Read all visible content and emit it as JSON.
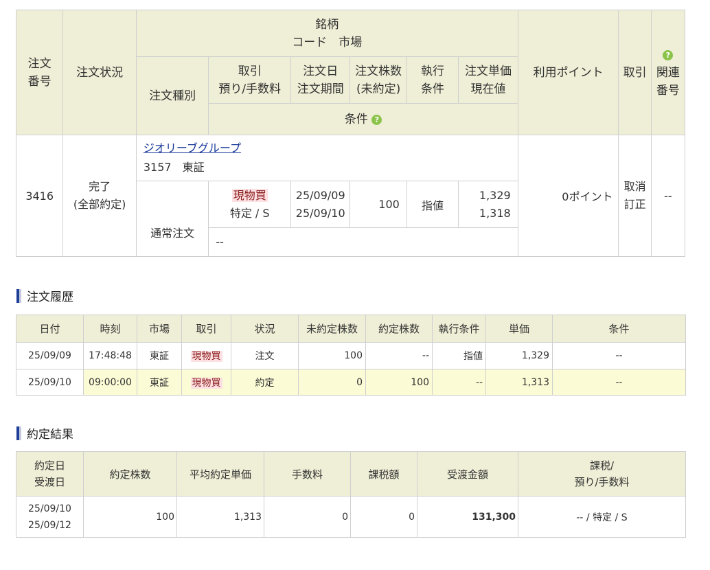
{
  "order_table": {
    "headers": {
      "order_no": [
        "注文",
        "番号"
      ],
      "status": "注文状況",
      "brand": "銘柄",
      "code_market": "コード　市場",
      "order_type": "注文種別",
      "trade": [
        "取引",
        "預り/手数料"
      ],
      "order_date": [
        "注文日",
        "注文期間"
      ],
      "qty": [
        "注文株数",
        "(未約定)"
      ],
      "exec": [
        "執行",
        "条件"
      ],
      "price": [
        "注文単価",
        "現在値"
      ],
      "condition": "条件",
      "points": "利用ポイント",
      "cancel": "取引",
      "related": [
        "関連",
        "番号"
      ]
    },
    "row": {
      "order_no": "3416",
      "status": [
        "完了",
        "(全部約定)"
      ],
      "company": "ジオリーブグループ",
      "code_market": "3157　東証",
      "order_type": "通常注文",
      "trade_tag": "現物買",
      "trade_account": "特定 / S",
      "order_date": "25/09/09",
      "order_period": "25/09/10",
      "qty": "100",
      "exec": "指値",
      "price": "1,329",
      "current": "1,318",
      "condition": "--",
      "points": "0ポイント",
      "actions": [
        "取消",
        "訂正"
      ],
      "related": "--"
    }
  },
  "history": {
    "title": "注文履歴",
    "headers": [
      "日付",
      "時刻",
      "市場",
      "取引",
      "状況",
      "未約定株数",
      "約定株数",
      "執行条件",
      "単価",
      "条件"
    ],
    "rows": [
      [
        "25/09/09",
        "17:48:48",
        "東証",
        "現物買",
        "注文",
        "100",
        "--",
        "指値",
        "1,329",
        "--"
      ],
      [
        "25/09/10",
        "09:00:00",
        "東証",
        "現物買",
        "約定",
        "0",
        "100",
        "--",
        "1,313",
        "--"
      ]
    ]
  },
  "results": {
    "title": "約定結果",
    "headers": {
      "date": [
        "約定日",
        "受渡日"
      ],
      "qty": "約定株数",
      "avg_price": "平均約定単価",
      "fee": "手数料",
      "tax": "課税額",
      "amount": "受渡金額",
      "tax_type": [
        "課税/",
        "預り/手数料"
      ]
    },
    "row": {
      "date1": "25/09/10",
      "date2": "25/09/12",
      "qty": "100",
      "avg_price": "1,313",
      "fee": "0",
      "tax": "0",
      "amount": "131,300",
      "tax_type": "-- / 特定 / S"
    }
  },
  "colors": {
    "header_bg": "#efeed6",
    "highlight_bg": "#fbfbd6",
    "tag_bg": "#fde0e2",
    "help_icon": "#8bc34a",
    "link": "#1a3a9a",
    "section_bar": "#1f3f99"
  }
}
